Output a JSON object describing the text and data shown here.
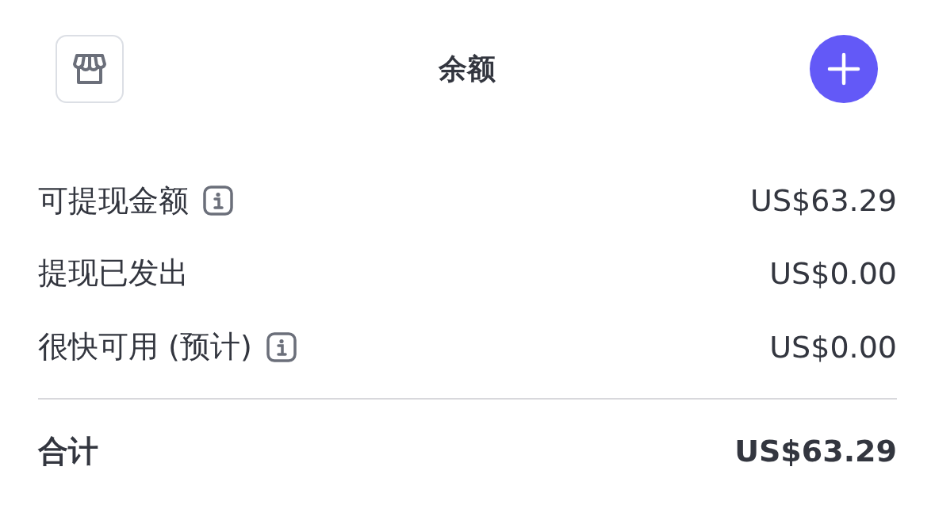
{
  "header": {
    "title": "余额"
  },
  "rows": [
    {
      "label": "可提现金额",
      "value": "US$63.29",
      "info": true
    },
    {
      "label": "提现已发出",
      "value": "US$0.00",
      "info": false
    },
    {
      "label": "很快可用 (预计)",
      "value": "US$0.00",
      "info": true
    }
  ],
  "total": {
    "label": "合计",
    "value": "US$63.29"
  }
}
